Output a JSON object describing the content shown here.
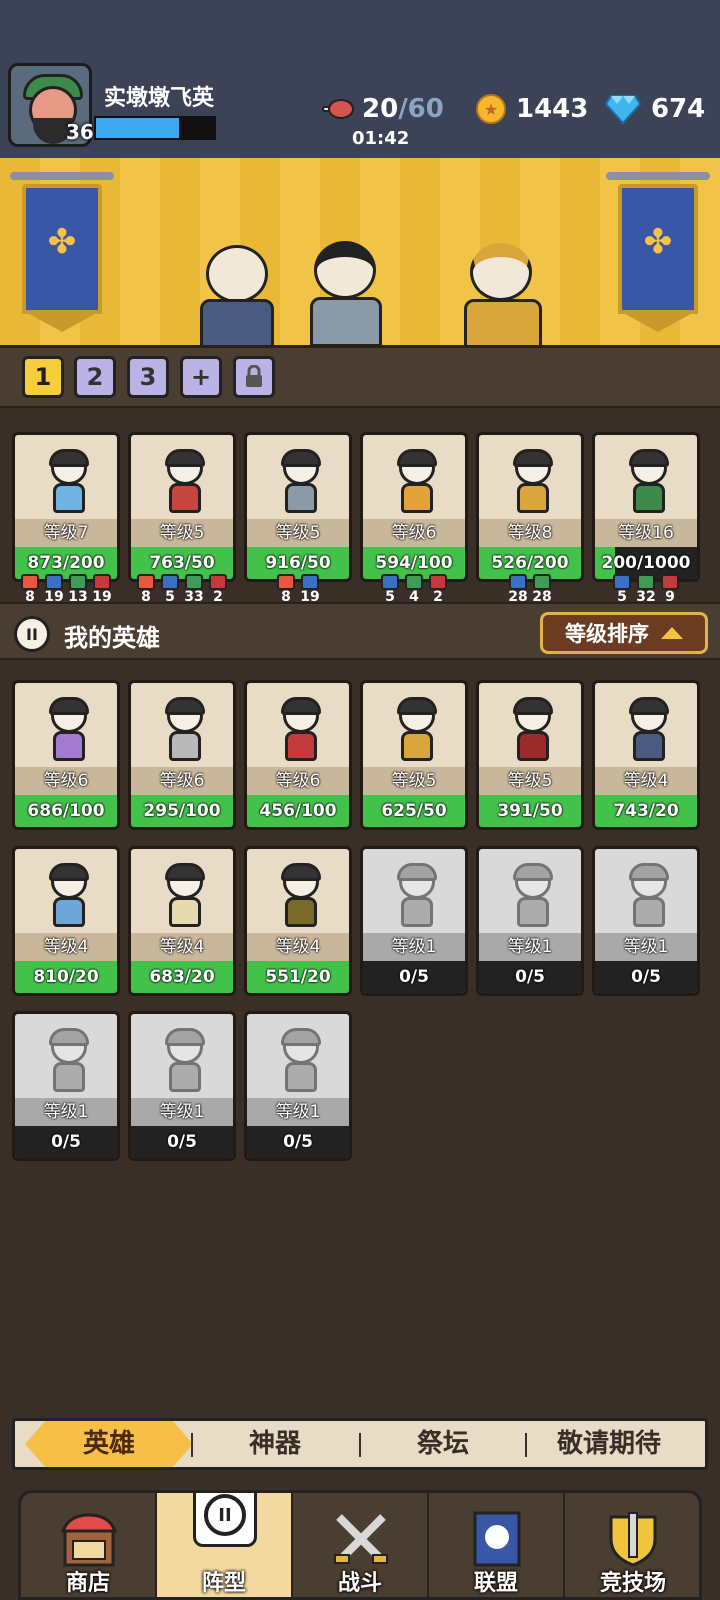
{
  "player": {
    "name": "实墩墩飞英",
    "level": "36",
    "xp_fraction": 0.7
  },
  "resources": {
    "stamina_current": "20",
    "stamina_max": "/60",
    "stamina_timer": "01:42",
    "gold": "1443",
    "gems": "674"
  },
  "team_slots": [
    "1",
    "2",
    "3",
    "+"
  ],
  "team_cards": [
    {
      "level": "等级7",
      "xp": "873/200",
      "xp_fraction": 1,
      "color": "#6fb3e3",
      "tags": [
        [
          "#e9573e",
          "8"
        ],
        [
          "#3a6fc4",
          "19"
        ],
        [
          "#3e9c55",
          "13"
        ],
        [
          "#c43a3a",
          "19"
        ]
      ]
    },
    {
      "level": "等级5",
      "xp": "763/50",
      "xp_fraction": 1,
      "color": "#c4463d",
      "tags": [
        [
          "#e9573e",
          "8"
        ],
        [
          "#3a6fc4",
          "5"
        ],
        [
          "#3e9c55",
          "33"
        ],
        [
          "#c43a3a",
          "2"
        ]
      ]
    },
    {
      "level": "等级5",
      "xp": "916/50",
      "xp_fraction": 1,
      "color": "#8a9aa6",
      "tags": [
        [
          "#e9573e",
          "8"
        ],
        [
          "#3a6fc4",
          "19"
        ]
      ]
    },
    {
      "level": "等级6",
      "xp": "594/100",
      "xp_fraction": 1,
      "color": "#e5a23a",
      "tags": [
        [
          "#3a6fc4",
          "5"
        ],
        [
          "#3e9c55",
          "4"
        ],
        [
          "#c43a3a",
          "2"
        ]
      ]
    },
    {
      "level": "等级8",
      "xp": "526/200",
      "xp_fraction": 1,
      "color": "#d9a63b",
      "tags": [
        [
          "#3a6fc4",
          "28"
        ],
        [
          "#3e9c55",
          "28"
        ]
      ]
    },
    {
      "level": "等级16",
      "xp": "200/1000",
      "xp_fraction": 0.2,
      "color": "#3d8a4a",
      "tags": [
        [
          "#3a6fc4",
          "5"
        ],
        [
          "#3e9c55",
          "32"
        ],
        [
          "#c43a3a",
          "9"
        ]
      ]
    }
  ],
  "my_heroes": {
    "title": "我的英雄",
    "sort_label": "等级排序",
    "cards": [
      {
        "level": "等级6",
        "xp": "686/100",
        "xp_fraction": 1,
        "color": "#a27bd1",
        "locked": false
      },
      {
        "level": "等级6",
        "xp": "295/100",
        "xp_fraction": 1,
        "color": "#b9b9b9",
        "locked": false
      },
      {
        "level": "等级6",
        "xp": "456/100",
        "xp_fraction": 1,
        "color": "#c43a3a",
        "locked": false
      },
      {
        "level": "等级5",
        "xp": "625/50",
        "xp_fraction": 1,
        "color": "#d9a63b",
        "locked": false
      },
      {
        "level": "等级5",
        "xp": "391/50",
        "xp_fraction": 1,
        "color": "#9b2a2a",
        "locked": false
      },
      {
        "level": "等级4",
        "xp": "743/20",
        "xp_fraction": 1,
        "color": "#4a5a80",
        "locked": false
      },
      {
        "level": "等级4",
        "xp": "810/20",
        "xp_fraction": 1,
        "color": "#6fa5d9",
        "locked": false
      },
      {
        "level": "等级4",
        "xp": "683/20",
        "xp_fraction": 1,
        "color": "#e7d9b0",
        "locked": false
      },
      {
        "level": "等级4",
        "xp": "551/20",
        "xp_fraction": 1,
        "color": "#7a6a2a",
        "locked": false
      },
      {
        "level": "等级1",
        "xp": "0/5",
        "xp_fraction": 0,
        "color": "#888888",
        "locked": true
      },
      {
        "level": "等级1",
        "xp": "0/5",
        "xp_fraction": 0,
        "color": "#888888",
        "locked": true
      },
      {
        "level": "等级1",
        "xp": "0/5",
        "xp_fraction": 0,
        "color": "#888888",
        "locked": true
      },
      {
        "level": "等级1",
        "xp": "0/5",
        "xp_fraction": 0,
        "color": "#888888",
        "locked": true
      },
      {
        "level": "等级1",
        "xp": "0/5",
        "xp_fraction": 0,
        "color": "#888888",
        "locked": true
      },
      {
        "level": "等级1",
        "xp": "0/5",
        "xp_fraction": 0,
        "color": "#888888",
        "locked": true
      }
    ]
  },
  "sub_tabs": [
    "英雄",
    "神器",
    "祭坛",
    "敬请期待"
  ],
  "bottom_nav": [
    "商店",
    "阵型",
    "战斗",
    "联盟",
    "竞技场"
  ],
  "colors": {
    "accent": "#f6bf46",
    "xp_green": "#42c24b",
    "xp_blue": "#3da7f0"
  }
}
